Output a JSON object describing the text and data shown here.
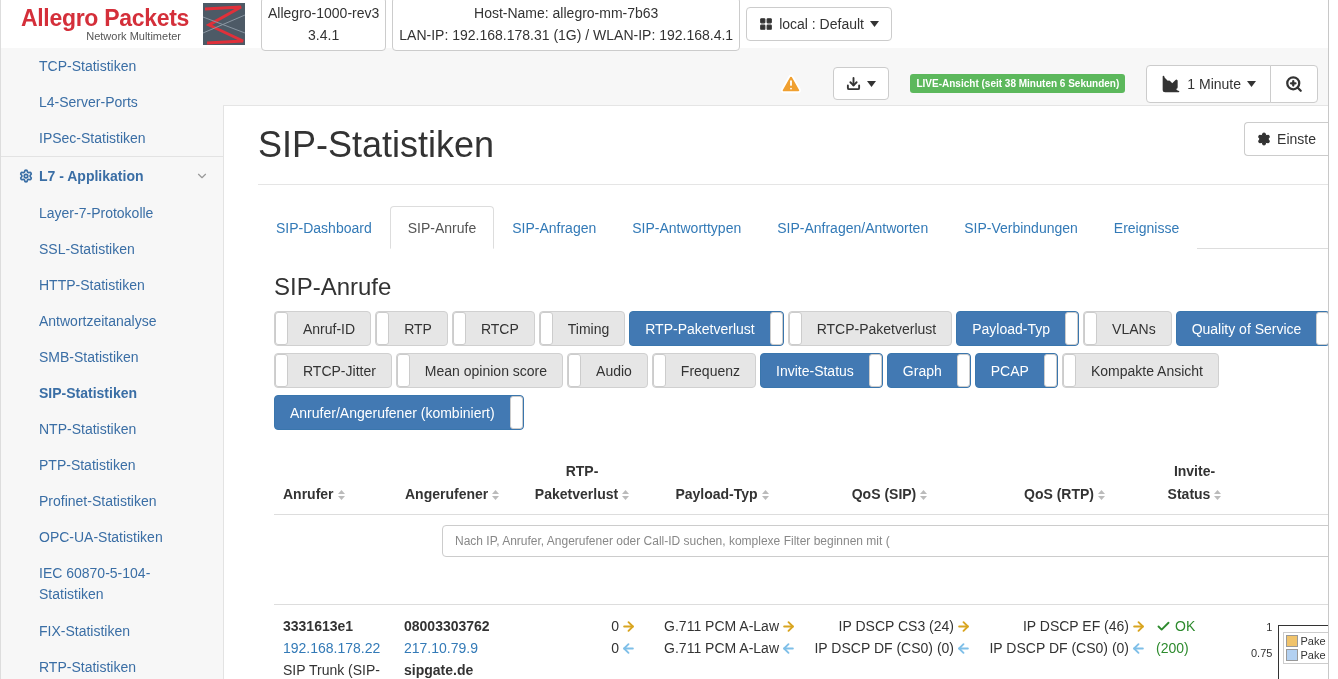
{
  "header": {
    "brand": "Allegro Packets",
    "subtitle": "Network Multimeter",
    "device": [
      "Allegro-1000-rev3",
      "3.4.1"
    ],
    "host": [
      "Host-Name: allegro-mm-7b63",
      "LAN-IP: 192.168.178.31 (1G) / WLAN-IP: 192.168.4.1"
    ],
    "profile": "local : Default"
  },
  "toolbar": {
    "warning": true,
    "live_badge": "LIVE-Ansicht (seit 38 Minuten 6 Sekunden)",
    "interval": "1 Minute"
  },
  "sidebar": {
    "items": [
      {
        "label": "TCP-Statistiken",
        "selected": false
      },
      {
        "label": "L4-Server-Ports",
        "selected": false
      },
      {
        "label": "IPSec-Statistiken",
        "selected": false
      },
      {
        "label": "L7 - Applikation",
        "kind": "group",
        "expanded": true,
        "children": [
          {
            "label": "Layer-7-Protokolle",
            "selected": false
          },
          {
            "label": "SSL-Statistiken",
            "selected": false
          },
          {
            "label": "HTTP-Statistiken",
            "selected": false
          },
          {
            "label": "Antwortzeitanalyse",
            "selected": false
          },
          {
            "label": "SMB-Statistiken",
            "selected": false
          },
          {
            "label": "SIP-Statistiken",
            "selected": true
          },
          {
            "label": "NTP-Statistiken",
            "selected": false
          },
          {
            "label": "PTP-Statistiken",
            "selected": false
          },
          {
            "label": "Profinet-Statistiken",
            "selected": false
          },
          {
            "label": "OPC-UA-Statistiken",
            "selected": false
          },
          {
            "label": "IEC 60870-5-104-Statistiken",
            "selected": false
          },
          {
            "label": "FIX-Statistiken",
            "selected": false
          },
          {
            "label": "RTP-Statistiken",
            "selected": false
          }
        ]
      }
    ]
  },
  "page": {
    "title": "SIP-Statistiken",
    "settings_button": "Einste"
  },
  "tabs": [
    {
      "label": "SIP-Dashboard",
      "selected": false
    },
    {
      "label": "SIP-Anrufe",
      "selected": true
    },
    {
      "label": "SIP-Anfragen",
      "selected": false
    },
    {
      "label": "SIP-Antworttypen",
      "selected": false
    },
    {
      "label": "SIP-Anfragen/Antworten",
      "selected": false
    },
    {
      "label": "SIP-Verbindungen",
      "selected": false
    },
    {
      "label": "Ereignisse",
      "selected": false
    }
  ],
  "section_title": "SIP-Anrufe",
  "toggle_rows": [
    [
      {
        "label": "Anruf-ID",
        "on": false
      },
      {
        "label": "RTP",
        "on": false
      },
      {
        "label": "RTCP",
        "on": false
      },
      {
        "label": "Timing",
        "on": false
      },
      {
        "label": "RTP-Paketverlust",
        "on": true
      },
      {
        "label": "RTCP-Paketverlust",
        "on": false
      },
      {
        "label": "Payload-Typ",
        "on": true
      },
      {
        "label": "VLANs",
        "on": false
      },
      {
        "label": "Quality of Service",
        "on": true
      }
    ],
    [
      {
        "label": "RTCP-Jitter",
        "on": false
      },
      {
        "label": "Mean opinion score",
        "on": false
      },
      {
        "label": "Audio",
        "on": false
      },
      {
        "label": "Frequenz",
        "on": false
      },
      {
        "label": "Invite-Status",
        "on": true
      },
      {
        "label": "Graph",
        "on": true
      },
      {
        "label": "PCAP",
        "on": true
      },
      {
        "label": "Kompakte Ansicht",
        "on": false
      }
    ],
    [
      {
        "label": "Anrufer/Angerufener (kombiniert)",
        "on": true
      }
    ]
  ],
  "table": {
    "columns": [
      [
        "Anrufer"
      ],
      [
        "Angerufener"
      ],
      [
        "RTP-",
        "Paketverlust"
      ],
      [
        "Payload-Typ"
      ],
      [
        "QoS (SIP)"
      ],
      [
        "QoS (RTP)"
      ],
      [
        "Invite-",
        "Status"
      ]
    ],
    "search_placeholder": "Nach IP, Anrufer, Angerufener oder Call-ID suchen, komplexe Filter beginnen mit (",
    "rows": [
      {
        "caller": {
          "id": "3331613e1",
          "ip": "192.168.178.22",
          "name": "SIP Trunk (SIP-"
        },
        "callee": {
          "number": "08003303762",
          "ip": "217.10.79.9",
          "host": "sipgate.de"
        },
        "loss": [
          {
            "text": "0",
            "kind": "out"
          },
          {
            "text": "0",
            "kind": "in"
          }
        ],
        "payload": [
          {
            "text": "G.711 PCM A-Law",
            "kind": "out"
          },
          {
            "text": "G.711 PCM A-Law",
            "kind": "in"
          }
        ],
        "qos_sip": [
          {
            "text": "IP DSCP CS3 (24)",
            "kind": "out"
          },
          {
            "text": "IP DSCP DF (CS0) (0)",
            "kind": "in"
          }
        ],
        "qos_rtp": [
          {
            "text": "IP DSCP EF (46)",
            "kind": "out"
          },
          {
            "text": "IP DSCP DF (CS0) (0)",
            "kind": "in"
          }
        ],
        "status": {
          "text": "OK",
          "code": "(200)",
          "ok": true
        },
        "graph": {
          "axis_labels": [
            "1",
            "0.75"
          ],
          "legend": [
            {
              "label": "Pake",
              "color": "#f0c36b"
            },
            {
              "label": "Pake",
              "color": "#b3d1f2"
            }
          ]
        }
      }
    ]
  }
}
